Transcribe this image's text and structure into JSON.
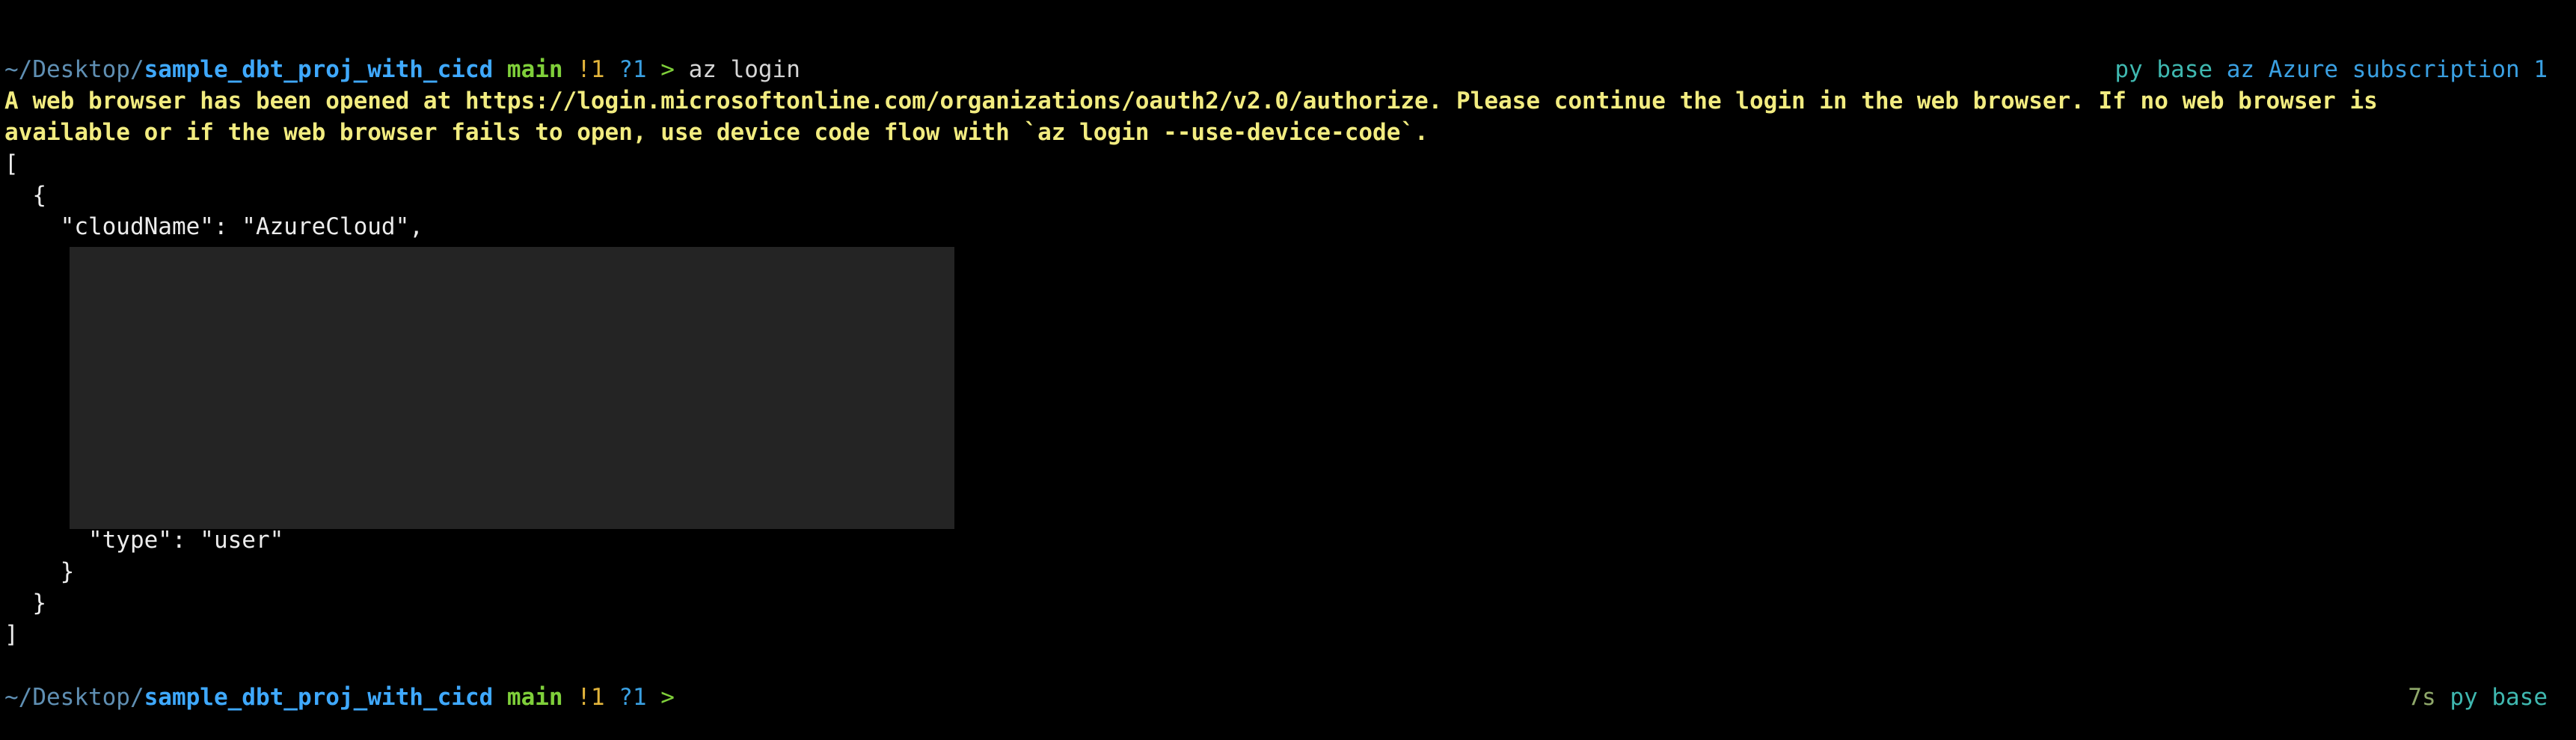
{
  "prompt1": {
    "path_prefix": "~/Desktop/",
    "path_dir": "sample_dbt_proj_with_cicd",
    "branch": "main",
    "modified": "!1",
    "untracked": "?1",
    "caret": ">",
    "command": "az login"
  },
  "rprompt1": {
    "env": "py base",
    "az_label": "az",
    "subscription": "Azure subscription 1"
  },
  "output": {
    "warning_line1": "A web browser has been opened at https://login.microsoftonline.com/organizations/oauth2/v2.0/authorize. Please continue the login in the web browser. If no web browser is",
    "warning_line2": "available or if the web browser fails to open, use device code flow with `az login --use-device-code`.",
    "json_lines": {
      "open_bracket": "[",
      "open_brace": "  {",
      "cloud_name": "    \"cloudName\": \"AzureCloud\",",
      "type_line": "      \"type\": \"user\"",
      "inner_close": "    }",
      "outer_close": "  }",
      "close_bracket": "]"
    }
  },
  "prompt2": {
    "path_prefix": "~/Desktop/",
    "path_dir": "sample_dbt_proj_with_cicd",
    "branch": "main",
    "modified": "!1",
    "untracked": "?1",
    "caret": ">"
  },
  "rprompt2": {
    "duration": "7s",
    "env": "py base"
  },
  "colors": {
    "background": "#000000",
    "path": "#3fa9ff",
    "branch": "#7fcf3a",
    "modified": "#e2b43b",
    "warning": "#f2ec80",
    "redaction": "#242424"
  }
}
